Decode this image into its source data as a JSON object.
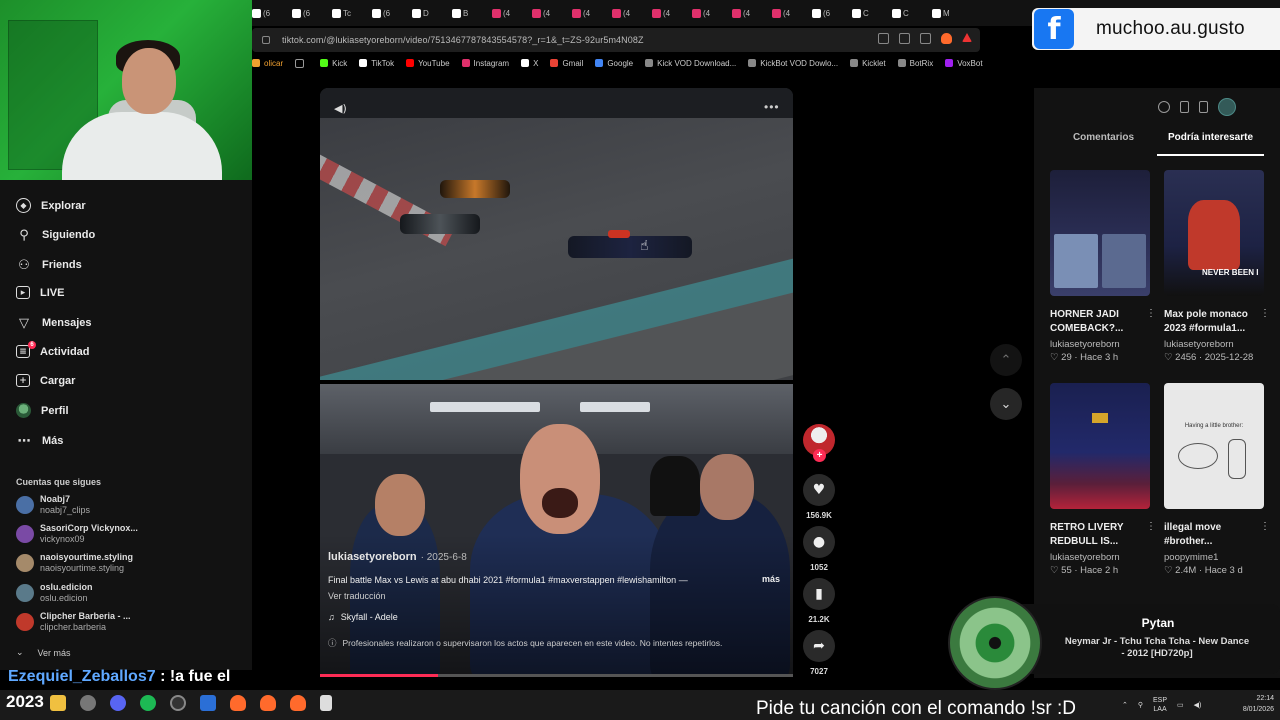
{
  "browser": {
    "tabs": [
      {
        "icon": "tiktok-icon",
        "label": "(6"
      },
      {
        "icon": "tiktok-icon",
        "label": "(6"
      },
      {
        "icon": "tiktok-icon",
        "label": "Tc"
      },
      {
        "icon": "tiktok-icon",
        "label": "(6"
      },
      {
        "icon": "tiktok-icon",
        "label": "D"
      },
      {
        "icon": "tiktok-icon",
        "label": "B"
      },
      {
        "icon": "instagram-icon",
        "label": "(4"
      },
      {
        "icon": "instagram-icon",
        "label": "(4"
      },
      {
        "icon": "instagram-icon",
        "label": "(4"
      },
      {
        "icon": "instagram-icon",
        "label": "(4"
      },
      {
        "icon": "instagram-icon",
        "label": "(4"
      },
      {
        "icon": "instagram-icon",
        "label": "(4"
      },
      {
        "icon": "instagram-icon",
        "label": "(4"
      },
      {
        "icon": "instagram-icon",
        "label": "(4"
      },
      {
        "icon": "tiktok-icon",
        "label": "(6"
      },
      {
        "icon": "tiktok-icon",
        "label": "C"
      },
      {
        "icon": "tiktok-icon",
        "label": "C"
      },
      {
        "icon": "tiktok-icon",
        "label": "M"
      }
    ],
    "url": "tiktok.com/@lukiasetyoreborn/video/7513467787843554578?_r=1&_t=ZS-92ur5m4N08Z",
    "bookmarks": [
      {
        "label": "olicar",
        "icon": "folder-icon"
      },
      {
        "label": "",
        "icon": "apps-icon"
      },
      {
        "label": "Kick",
        "icon": "kick-icon",
        "color": "#53fc18"
      },
      {
        "label": "TikTok",
        "icon": "tiktok-icon",
        "color": "#ffffff"
      },
      {
        "label": "YouTube",
        "icon": "youtube-icon",
        "color": "#ff0000"
      },
      {
        "label": "Instagram",
        "icon": "instagram-icon",
        "color": "#e1306c"
      },
      {
        "label": "X",
        "icon": "x-icon",
        "color": "#ffffff"
      },
      {
        "label": "Gmail",
        "icon": "gmail-icon",
        "color": "#ea4335"
      },
      {
        "label": "Google",
        "icon": "google-icon",
        "color": "#4285f4"
      },
      {
        "label": "Kick VOD Download...",
        "icon": "kick-vod-icon",
        "color": "#888888"
      },
      {
        "label": "KickBot VOD Dowlo...",
        "icon": "kickbot-icon",
        "color": "#888888"
      },
      {
        "label": "Kicklet",
        "icon": "kicklet-icon",
        "color": "#888888"
      },
      {
        "label": "BotRix",
        "icon": "botrix-icon",
        "color": "#888888"
      },
      {
        "label": "VoxBot",
        "icon": "voxbot-icon",
        "color": "#a020f0"
      }
    ]
  },
  "facebook_overlay": {
    "logo": "f",
    "handle": "muchoo.au.gusto"
  },
  "sidebar": {
    "items": [
      {
        "label": "Explorar",
        "icon": "compass-icon"
      },
      {
        "label": "Siguiendo",
        "icon": "person-icon"
      },
      {
        "label": "Friends",
        "icon": "friends-icon"
      },
      {
        "label": "LIVE",
        "icon": "live-icon"
      },
      {
        "label": "Mensajes",
        "icon": "messages-icon"
      },
      {
        "label": "Actividad",
        "icon": "activity-icon",
        "badge": "6"
      },
      {
        "label": "Cargar",
        "icon": "upload-icon"
      },
      {
        "label": "Perfil",
        "icon": "avatar-icon"
      },
      {
        "label": "Más",
        "icon": "more-icon"
      }
    ],
    "following_heading": "Cuentas que sigues",
    "following": [
      {
        "name": "Noabj7",
        "handle": "noabj7_clips",
        "color": "#4a6fa5"
      },
      {
        "name": "SasoriCorp Vickynox...",
        "handle": "vickynox09",
        "color": "#7a4aa5"
      },
      {
        "name": "naoisyourtime.styling",
        "handle": "naoisyourtime.styling",
        "color": "#a58a6a"
      },
      {
        "name": "oslu.edicion",
        "handle": "oslu.edicion",
        "color": "#5a7a8a"
      },
      {
        "name": "Clipcher Barberia - ...",
        "handle": "clipcher.barberia",
        "color": "#c0392b"
      }
    ],
    "see_more": "Ver más"
  },
  "video": {
    "author": "lukiasetyoreborn",
    "date": "· 2025-6-8",
    "caption": "Final battle Max vs Lewis at abu dhabi 2021 #formula1 #maxverstappen #lewishamilton —",
    "more": "más",
    "translate": "Ver traducción",
    "music": "Skyfall - Adele",
    "disclaimer": "Profesionales realizaron o supervisaron los actos que aparecen en este video. No intentes repetirlos.",
    "progress": 0.25,
    "likes": "156.9K",
    "comments": "1052",
    "saves": "21.2K",
    "shares": "7027"
  },
  "right_panel": {
    "tabs": [
      "Comentarios",
      "Podría interesarte"
    ],
    "active_tab": 1,
    "cards": [
      {
        "title": "HORNER JADI COMEBACK?...",
        "author": "lukiasetyoreborn",
        "meta": "♡ 29 · Hace 3 h",
        "thumb_overlay": ""
      },
      {
        "title": "Max pole monaco 2023 #formula1...",
        "author": "lukiasetyoreborn",
        "meta": "♡ 2456 · 2025-12-28",
        "thumb_overlay": "NEVER BEEN I"
      },
      {
        "title": "RETRO LIVERY REDBULL IS...",
        "author": "lukiasetyoreborn",
        "meta": "♡ 55 · Hace 2 h",
        "thumb_overlay": ""
      },
      {
        "title": "illegal move #brother...",
        "author": "poopymime1",
        "meta": "♡ 2.4M · Hace 3 d",
        "thumb_overlay": "Having a little brother:"
      }
    ]
  },
  "now_playing": {
    "user": "Pytan",
    "song": "Neymar Jr - Tchu Tcha Tcha - New Dance - 2012 [HD720p]"
  },
  "chat": {
    "user": "Ezequiel_Zeballos7",
    "separator": ":",
    "message": "!a fue el"
  },
  "taskbar": {
    "year": "2023",
    "banner": "Pide tu canción con el comando !sr :D",
    "lang_top": "ESP",
    "lang_bottom": "LAA",
    "time": "22:14",
    "date": "8/01/2026"
  }
}
